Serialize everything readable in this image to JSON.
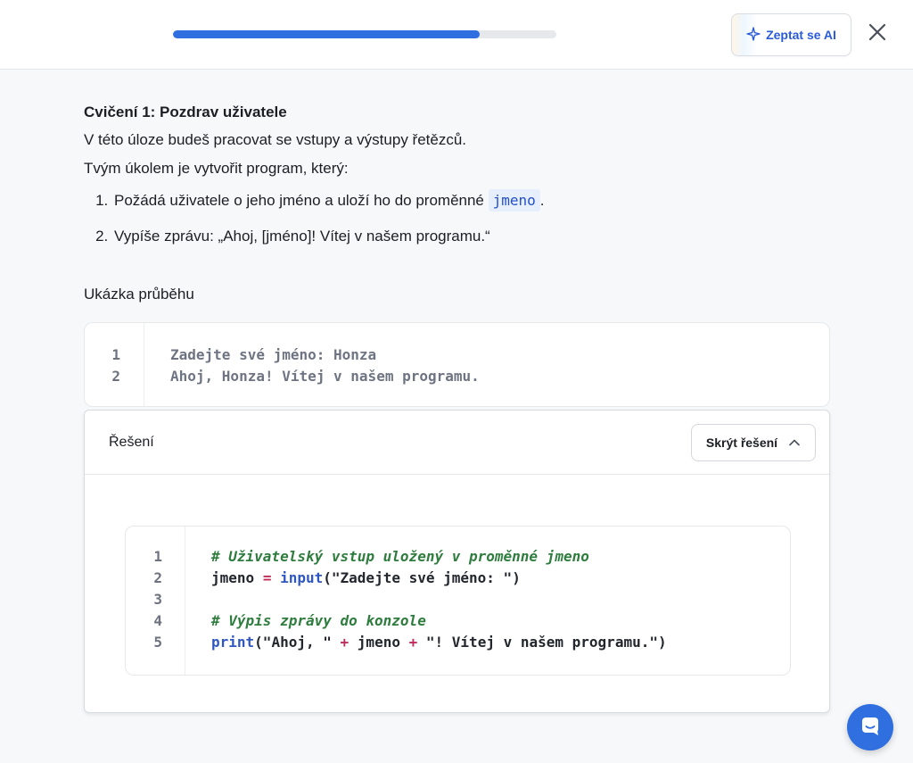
{
  "header": {
    "progress_percent": 80,
    "ask_ai_label": "Zeptat se AI"
  },
  "exercise": {
    "title": "Cvičení 1: Pozdrav uživatele",
    "intro": "V této úloze budeš pracovat se vstupy a výstupy řetězců.",
    "task_intro": "Tvým úkolem je vytvořit program, který:",
    "tasks": [
      {
        "before": "Požádá uživatele o jeho jméno a uloží ho do proměnné ",
        "code": "jmeno",
        "after": "."
      },
      {
        "text": "Vypíše zprávu: „Ahoj, [jméno]! Vítej v našem programu.“"
      }
    ]
  },
  "sample": {
    "label": "Ukázka průběhu",
    "line_numbers": [
      "1",
      "2"
    ],
    "lines": [
      "Zadejte své jméno: Honza",
      "Ahoj, Honza! Vítej v našem programu."
    ]
  },
  "solution": {
    "title": "Řešení",
    "hide_label": "Skrýt řešení",
    "line_numbers": [
      "1",
      "2",
      "3",
      "4",
      "5"
    ],
    "code": {
      "l1_comment": "# Uživatelský vstup uložený v proměnné jmeno",
      "l2_var": "jmeno",
      "l2_eq": "=",
      "l2_fn": "input",
      "l2_args": "(\"Zadejte své jméno: \")",
      "l4_comment": "# Výpis zprávy do konzole",
      "l5_fn": "print",
      "l5_a": "(\"Ahoj, \"",
      "l5_plus1": "+",
      "l5_var": "jmeno",
      "l5_plus2": "+",
      "l5_b": "\"! Vítej v našem programu.\")"
    }
  },
  "colors": {
    "accent": "#2f6fe0",
    "comment": "#2e7d3e",
    "keyword": "#2f57c2",
    "operator": "#c12c5a"
  },
  "icons": {
    "ask_ai": "sparkle-icon",
    "close": "close-icon",
    "hide": "chevron-up-icon",
    "chat": "chat-icon"
  }
}
